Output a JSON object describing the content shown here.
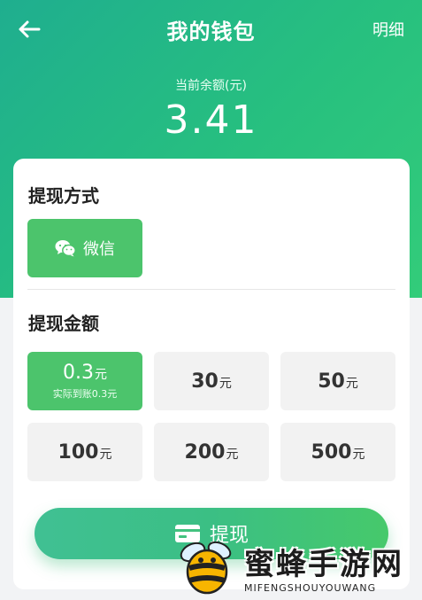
{
  "header": {
    "title": "我的钱包",
    "detail_label": "明细",
    "back_icon": "arrow-left-icon",
    "gradient_colors": [
      "#1fae8f",
      "#33cc7a"
    ]
  },
  "balance": {
    "label": "当前余额(元)",
    "value": "3.41"
  },
  "withdraw_method": {
    "title": "提现方式",
    "selected": {
      "label": "微信",
      "icon": "wechat-icon"
    }
  },
  "withdraw_amount": {
    "title": "提现金额",
    "options": [
      {
        "value": "0.3",
        "unit": "元",
        "sub": "实际到账0.3元",
        "selected": true
      },
      {
        "value": "30",
        "unit": "元",
        "selected": false
      },
      {
        "value": "50",
        "unit": "元",
        "selected": false
      },
      {
        "value": "100",
        "unit": "元",
        "selected": false
      },
      {
        "value": "200",
        "unit": "元",
        "selected": false
      },
      {
        "value": "500",
        "unit": "元",
        "selected": false
      }
    ]
  },
  "submit": {
    "label": "提现",
    "icon": "card-icon"
  },
  "watermark": {
    "text": "蜜蜂手游网",
    "sub": "MIFENGSHOUYOUWANG"
  },
  "colors": {
    "accent": "#4cc46c",
    "background": "#f2f3f5"
  }
}
